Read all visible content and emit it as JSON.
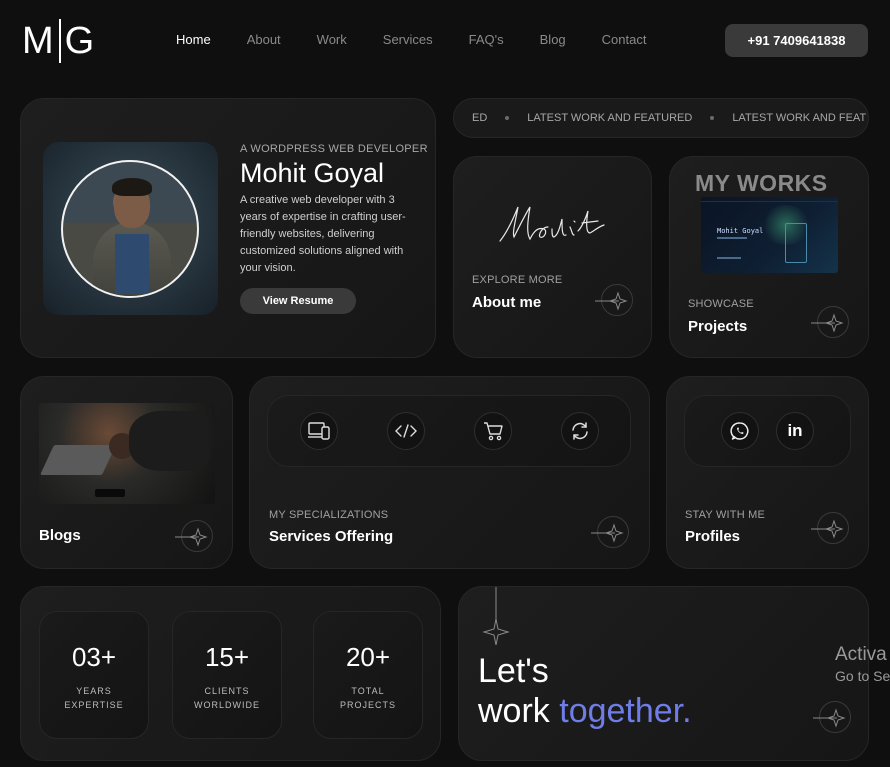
{
  "header": {
    "logo_left": "M",
    "logo_right": "G",
    "nav": [
      "Home",
      "About",
      "Work",
      "Services",
      "FAQ's",
      "Blog",
      "Contact"
    ],
    "active_nav": "Home",
    "phone": "+91 7409641838"
  },
  "profile": {
    "subtitle": "A WORDPRESS WEB DEVELOPER",
    "name": "Mohit Goyal",
    "description": "A creative web developer with 3 years of expertise in crafting user-friendly websites, delivering customized solutions aligned with your vision.",
    "button": "View Resume"
  },
  "ticker": {
    "items": [
      "ED",
      "LATEST WORK AND FEATURED",
      "LATEST WORK AND FEAT"
    ]
  },
  "about_card": {
    "signature": "Mohit",
    "sub": "EXPLORE MORE",
    "title": "About me"
  },
  "works_card": {
    "heading": "MY WORKS",
    "shot_name": "Mohit Goyal",
    "sub": "SHOWCASE",
    "title": "Projects"
  },
  "blogs_card": {
    "title": "Blogs"
  },
  "services_card": {
    "icons": [
      "devices-icon",
      "code-icon",
      "cart-icon",
      "refresh-icon"
    ],
    "sub": "MY SPECIALIZATIONS",
    "title": "Services Offering"
  },
  "profiles_card": {
    "icons": [
      "whatsapp-icon",
      "linkedin-icon"
    ],
    "linkedin_text": "in",
    "sub": "STAY WITH ME",
    "title": "Profiles"
  },
  "stats": [
    {
      "num": "03+",
      "line1": "YEARS",
      "line2": "EXPERTISE"
    },
    {
      "num": "15+",
      "line1": "CLIENTS",
      "line2": "WORLDWIDE"
    },
    {
      "num": "20+",
      "line1": "TOTAL",
      "line2": "PROJECTS"
    }
  ],
  "cta": {
    "line1": "Let's",
    "line2_a": "work",
    "line2_b": "together."
  },
  "overlay": {
    "line1": "Activa",
    "line2": "Go to Se"
  },
  "colors": {
    "background": "#0f0f0f",
    "accent_blue": "#6f7de6",
    "card": "#1b1b1b"
  }
}
